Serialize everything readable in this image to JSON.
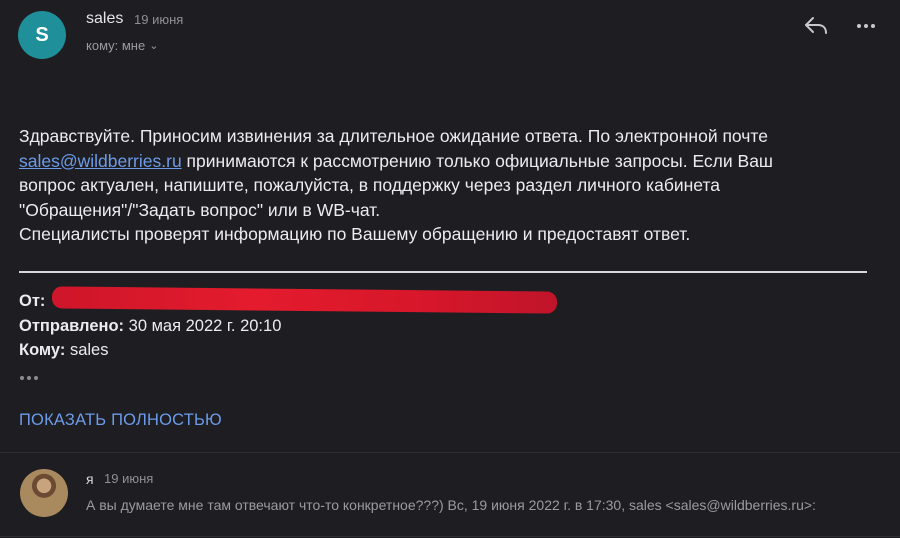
{
  "message": {
    "avatar_letter": "S",
    "sender": "sales",
    "date": "19 июня",
    "to_label": "кому: мне",
    "body": {
      "line1": "Здравствуйте. Приносим извинения за длительное ожидание ответа. По электронной почте",
      "email_link": "sales@wildberries.ru",
      "line2_rest": " принимаются к рассмотрению только официальные запросы. Если Ваш",
      "line3": "вопрос актуален, напишите, пожалуйста, в поддержку через раздел личного кабинета",
      "line4": "\"Обращения\"/\"Задать вопрос\" или в WB-чат.",
      "line5": "Специалисты проверят информацию по Вашему обращению и предоставят ответ."
    },
    "quoted": {
      "from_label": "От:",
      "sent_label": "Отправлено:",
      "sent_value": "30 мая 2022 г. 20:10",
      "to_label": "Кому:",
      "to_value": "sales"
    },
    "show_all_label": "ПОКАЗАТЬ ПОЛНОСТЬЮ"
  },
  "reply_preview": {
    "sender": "я",
    "date": "19 июня",
    "snippet": "А вы думаете мне там отвечают что-то конкретное???) Вс, 19 июня 2022 г. в 17:30, sales <sales@wildberries.ru>:"
  },
  "icons": {
    "reply": "reply-icon",
    "more": "more-icon",
    "chevron": "chevron-down-icon"
  },
  "colors": {
    "background": "#1e1e22",
    "avatar": "#1f8f99",
    "link": "#6c9be8",
    "redaction": "#e8192c"
  }
}
